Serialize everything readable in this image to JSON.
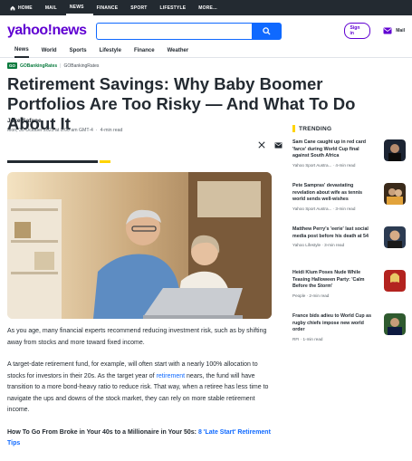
{
  "topbar": {
    "items": [
      "HOME",
      "MAIL",
      "NEWS",
      "FINANCE",
      "SPORT",
      "LIFESTYLE",
      "MORE..."
    ]
  },
  "header": {
    "logo": "yahoo!news",
    "search_placeholder": "",
    "signin": "Sign in",
    "mail": "Mail"
  },
  "nav": {
    "items": [
      "News",
      "World",
      "Sports",
      "Lifestyle",
      "Finance",
      "Weather"
    ]
  },
  "provider": {
    "logo": "GO",
    "name": "GOBankingRates",
    "name2": "GOBankingRates"
  },
  "article": {
    "headline": "Retirement Savings: Why Baby Boomer Portfolios Are Too Risky — And What To Do About It",
    "author": "Jake Safane",
    "date": "Mon, 30 October 2023 at 8:00 am GMT-4",
    "read_time": "4-min read",
    "p1": "As you age, many financial experts recommend reducing investment risk, such as by shifting away from stocks and more toward fixed income.",
    "p2_a": "A target-date retirement fund, for example, will often start with a nearly 100% allocation to stocks for investors in their 20s. As the target year of ",
    "p2_link": "retirement",
    "p2_b": " nears, the fund will have transition to a more bond-heavy ratio to reduce risk. That way, when a retiree has less time to navigate the ups and downs of the stock market, they can rely on more stable retirement income.",
    "p3_a": "How To Go From Broke in Your 40s to a Millionaire in Your 50s: ",
    "p3_link": "8 'Late Start' Retirement Tips"
  },
  "trending": {
    "heading": "TRENDING",
    "items": [
      {
        "title": "Sam Cane caught up in red card 'farce' during World Cup final against South Africa",
        "source": "Yahoo Sport Austra...",
        "time": "4-min read"
      },
      {
        "title": "Pete Sampras' devastating revelation about wife as tennis world sends well-wishes",
        "source": "Yahoo Sport Austra...",
        "time": "3-min read"
      },
      {
        "title": "Matthew Perry's 'eerie' last social media post before his death at 54",
        "source": "Yahoo Lifestyle",
        "time": "3-min read"
      },
      {
        "title": "Heidi Klum Poses Nude While Teasing Halloween Party: 'Calm Before the Storm'",
        "source": "People",
        "time": "2-min read"
      },
      {
        "title": "France bids adieu to World Cup as rugby chiefs impose new world order",
        "source": "RFI",
        "time": "1-min read"
      }
    ]
  }
}
